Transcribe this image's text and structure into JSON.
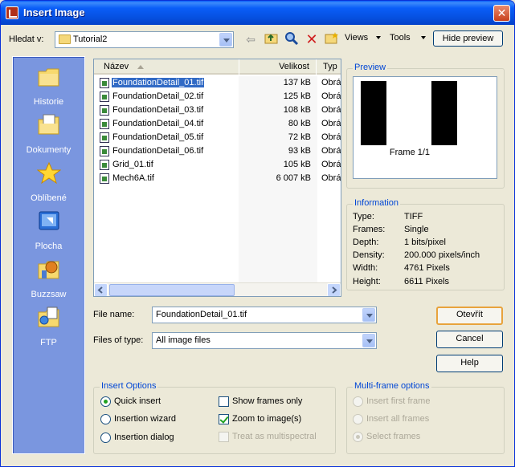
{
  "window": {
    "title": "Insert Image",
    "close_glyph": "✕"
  },
  "lookin": {
    "label": "Hledat v:",
    "value": "Tutorial2"
  },
  "toolbar": {
    "views_label": "Views",
    "tools_label": "Tools",
    "hide_preview_label": "Hide preview",
    "icons": [
      "back-icon",
      "up-folder-icon",
      "search-web-icon",
      "delete-icon",
      "new-folder-icon"
    ]
  },
  "places": [
    {
      "label": "Historie",
      "icon": "history-folder-icon"
    },
    {
      "label": "Dokumenty",
      "icon": "documents-folder-icon"
    },
    {
      "label": "Oblíbené",
      "icon": "favorites-star-icon"
    },
    {
      "label": "Plocha",
      "icon": "desktop-icon"
    },
    {
      "label": "Buzzsaw",
      "icon": "buzzsaw-icon"
    },
    {
      "label": "FTP",
      "icon": "ftp-icon"
    }
  ],
  "filelist": {
    "columns": {
      "name": "Název",
      "size": "Velikost",
      "type": "Typ"
    },
    "rows": [
      {
        "name": "FoundationDetail_01.tif",
        "size": "137 kB",
        "type": "Obrá",
        "selected": true
      },
      {
        "name": "FoundationDetail_02.tif",
        "size": "125 kB",
        "type": "Obrá"
      },
      {
        "name": "FoundationDetail_03.tif",
        "size": "108 kB",
        "type": "Obrá"
      },
      {
        "name": "FoundationDetail_04.tif",
        "size": "80 kB",
        "type": "Obrá"
      },
      {
        "name": "FoundationDetail_05.tif",
        "size": "72 kB",
        "type": "Obrá"
      },
      {
        "name": "FoundationDetail_06.tif",
        "size": "93 kB",
        "type": "Obrá"
      },
      {
        "name": "Grid_01.tif",
        "size": "105 kB",
        "type": "Obrá"
      },
      {
        "name": "Mech6A.tif",
        "size": "6 007 kB",
        "type": "Obrá"
      }
    ]
  },
  "preview": {
    "title": "Preview",
    "caption": "Frame 1/1"
  },
  "information": {
    "title": "Information",
    "rows": [
      {
        "label": "Type:",
        "value": "TIFF"
      },
      {
        "label": "Frames:",
        "value": "Single"
      },
      {
        "label": "Depth:",
        "value": "1 bits/pixel"
      },
      {
        "label": "Density:",
        "value": "200.000 pixels/inch"
      },
      {
        "label": "Width:",
        "value": "4761 Pixels"
      },
      {
        "label": "Height:",
        "value": "6611 Pixels"
      }
    ]
  },
  "form": {
    "filename_label": "File name:",
    "filename_value": "FoundationDetail_01.tif",
    "filetype_label": "Files of type:",
    "filetype_value": "All image files"
  },
  "buttons": {
    "open": "Otevřít",
    "cancel": "Cancel",
    "help": "Help"
  },
  "insert_options": {
    "title": "Insert Options",
    "quick_insert": "Quick insert",
    "insertion_wizard": "Insertion wizard",
    "insertion_dialog": "Insertion dialog",
    "show_frames_only": "Show frames only",
    "zoom_to_image": "Zoom to image(s)",
    "treat_multispectral": "Treat as multispectral"
  },
  "multiframe": {
    "title": "Multi-frame options",
    "insert_first": "Insert first frame",
    "insert_all": "Insert all frames",
    "select_frames": "Select frames"
  },
  "colors": {
    "title_bar": "#0a5ef8",
    "places_bar": "#7a96df",
    "selection": "#316ac5",
    "group_title": "#0046d5"
  }
}
